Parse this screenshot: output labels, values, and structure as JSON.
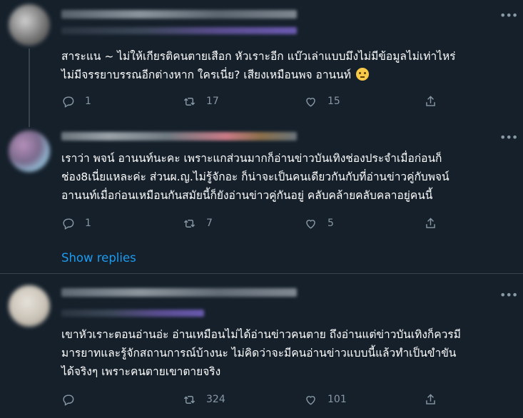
{
  "tweets": [
    {
      "text_lines": [
        "สาระแน ~ ไม่ให้เกียรติคนตายเสือก หัวเราะอีก แบ๊วเล่าแบบมึงไม่มีข้อมูลไม่เท่าไหร่",
        "ไม่มีจรรยาบรรณอีกต่างหาก ใครเนี่ย? เสียงเหมือนพจ อานนท์"
      ],
      "emoji": "face-with-rolling-eyes",
      "replies": "1",
      "retweets": "17",
      "likes": "15"
    },
    {
      "text_lines": [
        "เราว่า พจน์ อานนท์นะคะ เพราะแกส่วนมากก็อ่านข่าวบันเทิงช่องประจำเมื่อก่อนก็",
        "ช่อง8เนี่ยแหละค่ะ ส่วนผ.ญ.ไม่รู้จักอะ ก็น่าจะเป็นคนเดียวกันกับที่อ่านข่าวคู่กับพจน์",
        "อานนท์เมื่อก่อนเหมือนกันสมัยนี้ก็ยังอ่านข่าวคู่กันอยู่ คลับคล้ายคลับคลาอยู่คนนี้"
      ],
      "replies": "1",
      "retweets": "7",
      "likes": "5"
    },
    {
      "text_lines": [
        "เขาหัวเราะตอนอ่านอ่ะ อ่านเหมือนไม่ได้อ่านข่าวคนตาย ถึงอ่านแต่ข่าวบันเทิงก็ควรมี",
        "มารยาทและรู้จักสถานการณ์บ้างนะ ไม่คิดว่าจะมีคนอ่านข่าวแบบนี้แล้วทำเป็นขำขัน",
        "ได้จริงๆ เพราะคนตายเขาตายจริง"
      ],
      "replies": "",
      "retweets": "324",
      "likes": "101"
    }
  ],
  "show_replies_label": "Show replies",
  "colors": {
    "background": "#15202b",
    "text": "#ffffff",
    "muted": "#8899a6",
    "link": "#1d9bf0",
    "divider": "#38444d"
  }
}
